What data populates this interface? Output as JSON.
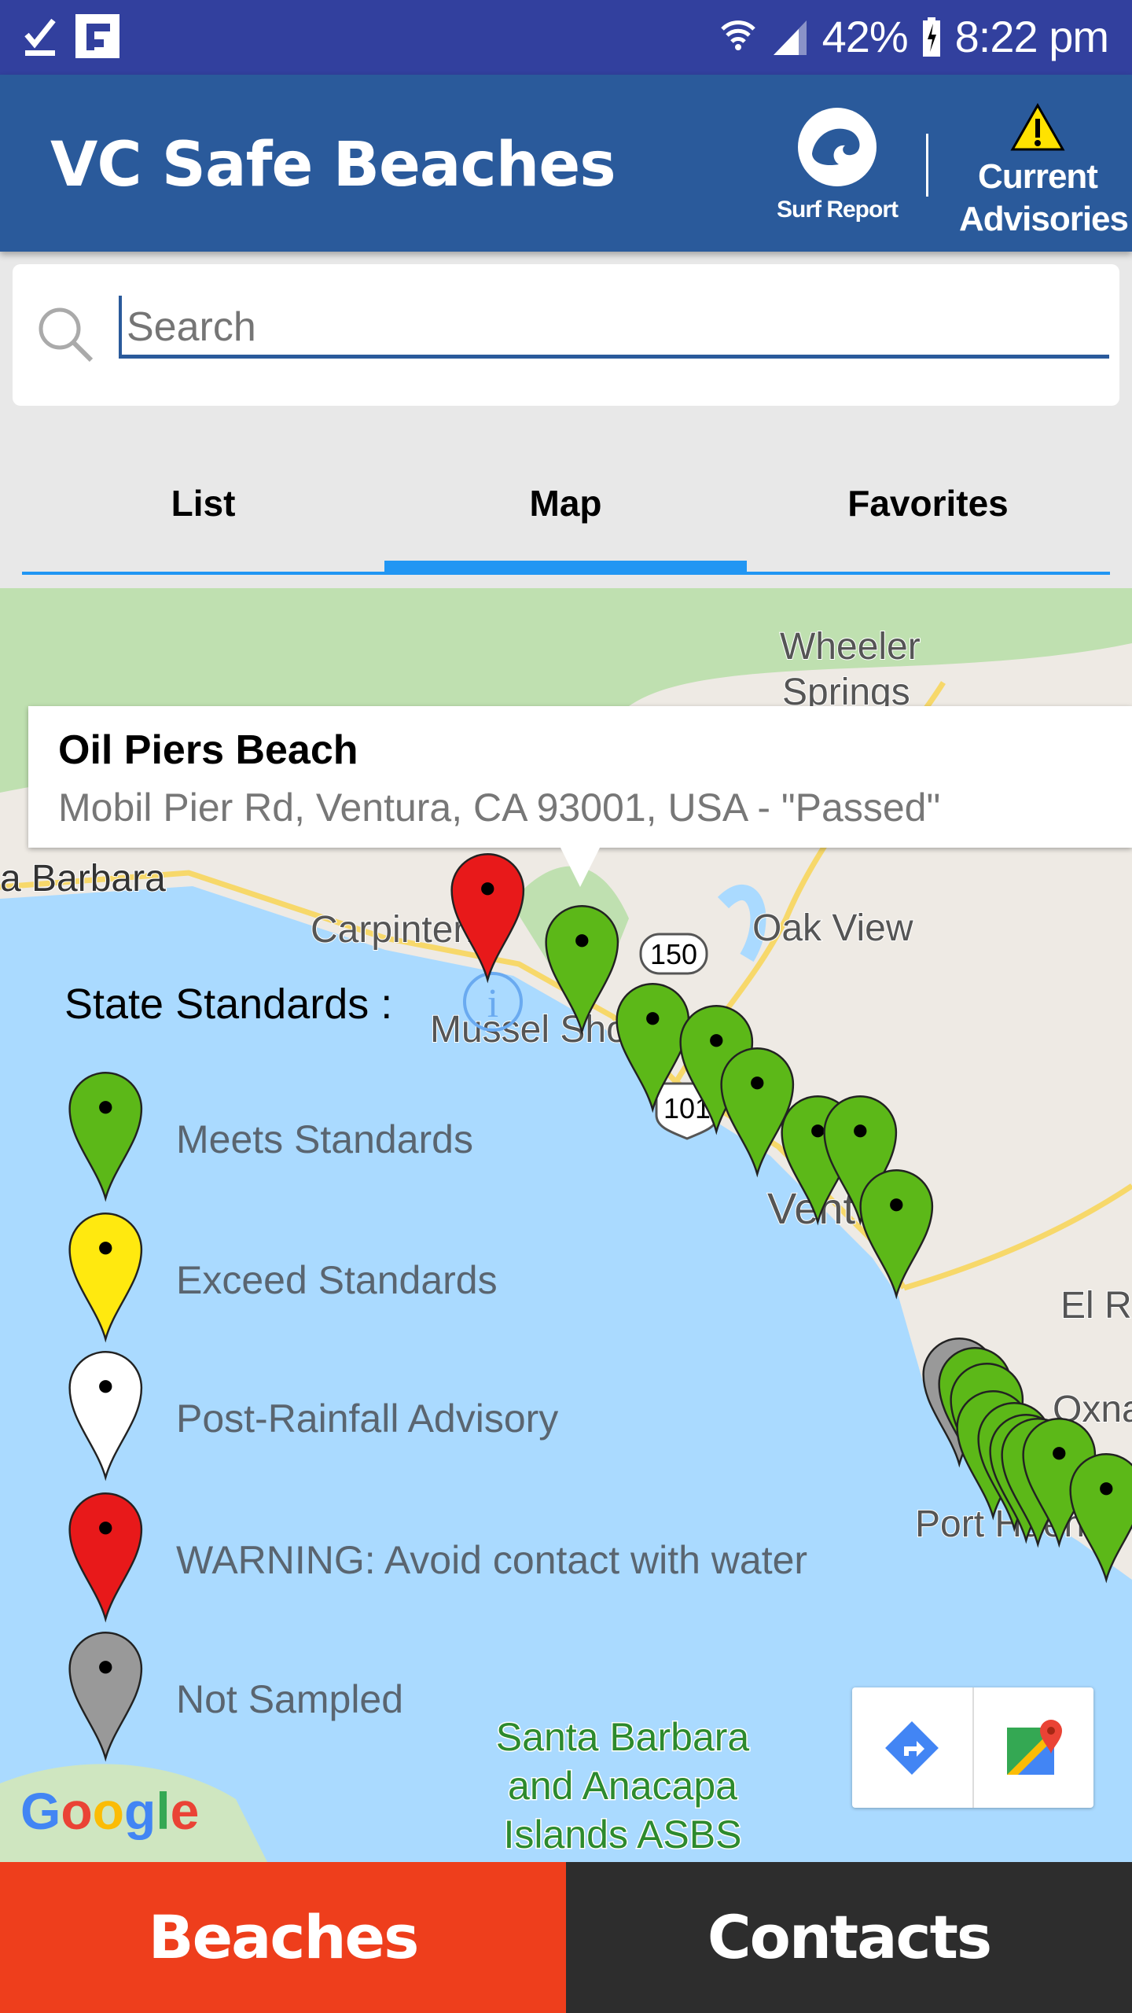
{
  "status_bar": {
    "battery": "42%",
    "time": "8:22 pm"
  },
  "app_bar": {
    "title": "VC Safe Beaches",
    "surf_report": "Surf Report",
    "advisories_line1": "Current",
    "advisories_line2": "Advisories"
  },
  "search": {
    "placeholder": "Search"
  },
  "tabs": [
    {
      "label": "List"
    },
    {
      "label": "Map",
      "active": true
    },
    {
      "label": "Favorites"
    }
  ],
  "map": {
    "place_labels": [
      "Wheeler",
      "Springs",
      "a Barbara",
      "Carpinteri",
      "Oak View",
      "Mussel Sho",
      "Vent",
      "El Ri",
      "Oxnard",
      "Port Huen"
    ],
    "shields": [
      "150",
      "101"
    ],
    "asbs": [
      "Santa Barbara",
      "and Anacapa",
      "Islands ASBS"
    ],
    "popup": {
      "title": "Oil Piers Beach",
      "subtitle": "Mobil Pier Rd, Ventura, CA 93001, USA - \"Passed\""
    },
    "legend": {
      "title": "State Standards :",
      "items": [
        {
          "label": "Meets Standards",
          "color": "#5cb818"
        },
        {
          "label": "Exceed Standards",
          "color": "#ffe90f"
        },
        {
          "label": "Post-Rainfall Advisory",
          "color": "#ffffff"
        },
        {
          "label": "WARNING: Avoid contact with water",
          "color": "#e8191a"
        },
        {
          "label": "Not Sampled",
          "color": "#999999"
        }
      ]
    },
    "markers": [
      "warning",
      "meets",
      "meets",
      "meets",
      "meets",
      "meets",
      "meets",
      "meets",
      "not-sampled",
      "meets",
      "meets",
      "meets",
      "meets",
      "meets",
      "meets",
      "meets",
      "meets"
    ],
    "google_logo": "Google"
  },
  "bottom_nav": {
    "beaches": "Beaches",
    "contacts": "Contacts",
    "beaches_color": "#ee3e1c",
    "contacts_color": "#2d2d2d"
  }
}
